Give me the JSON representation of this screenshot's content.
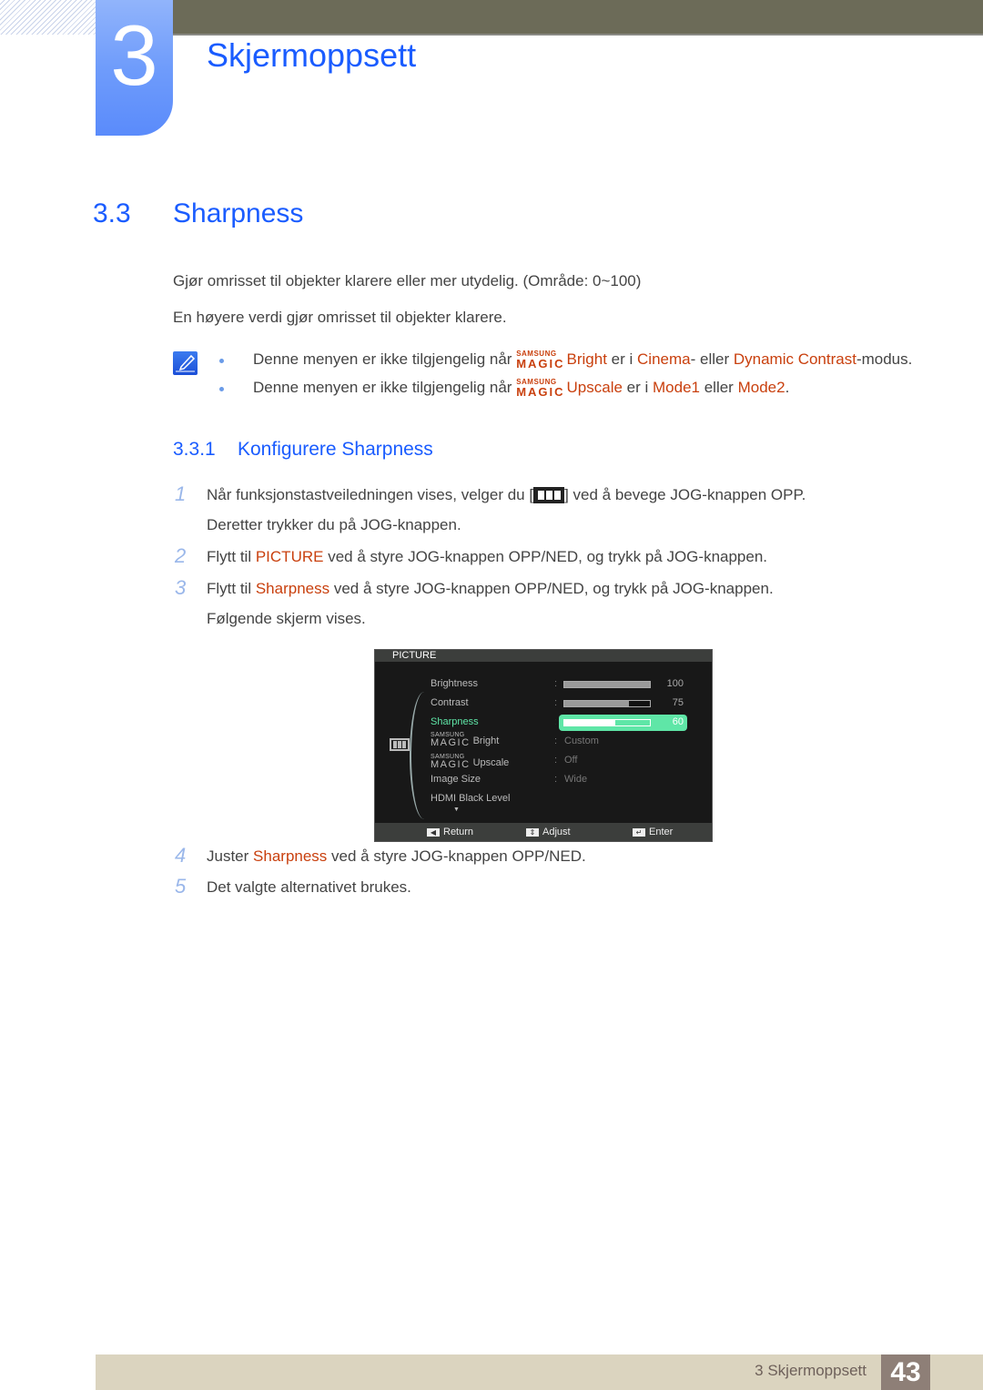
{
  "chapter": {
    "number": "3",
    "title": "Skjermoppsett"
  },
  "section": {
    "number": "3.3",
    "title": "Sharpness"
  },
  "intro": [
    "Gjør omrisset til objekter klarere eller mer utydelig. (Område: 0~100)",
    "En høyere verdi gjør omrisset til objekter klarere."
  ],
  "notes": [
    {
      "pre": "Denne menyen er ikke tilgjengelig når",
      "magic_top": "SAMSUNG",
      "magic_bottom": "MAGIC",
      "feature": "Bright",
      "mid": " er i ",
      "opt1": "Cinema",
      "mid2": "- eller ",
      "opt2": "Dynamic Contrast",
      "post": "-modus."
    },
    {
      "pre": "Denne menyen er ikke tilgjengelig når",
      "magic_top": "SAMSUNG",
      "magic_bottom": "MAGIC",
      "feature": "Upscale",
      "mid": " er i ",
      "opt1": "Mode1",
      "mid2": " eller ",
      "opt2": "Mode2",
      "post": "."
    }
  ],
  "subsection": {
    "number": "3.3.1",
    "title": "Konfigurere Sharpness"
  },
  "steps": [
    {
      "num": "1",
      "a": "Når funksjonstastveiledningen vises, velger du [",
      "b": "] ved å bevege JOG-knappen OPP.",
      "line2": "Deretter trykker du på JOG-knappen."
    },
    {
      "num": "2",
      "a": "Flytt til ",
      "hl": "PICTURE",
      "b": " ved å styre JOG-knappen OPP/NED, og trykk på JOG-knappen."
    },
    {
      "num": "3",
      "a": "Flytt til ",
      "hl": "Sharpness",
      "b": " ved å styre JOG-knappen OPP/NED, og trykk på JOG-knappen.",
      "line2": "Følgende skjerm vises."
    },
    {
      "num": "4",
      "a": "Juster ",
      "hl": "Sharpness",
      "b": " ved å styre JOG-knappen OPP/NED."
    },
    {
      "num": "5",
      "a": "Det valgte alternativet brukes."
    }
  ],
  "osd": {
    "title": "PICTURE",
    "items": [
      {
        "label": "Brightness",
        "value": 100,
        "value_text": "100"
      },
      {
        "label": "Contrast",
        "value": 75,
        "value_text": "75"
      },
      {
        "label": "Sharpness",
        "value": 60,
        "value_text": "60",
        "selected": true
      },
      {
        "magic_top": "SAMSUNG",
        "magic_bottom": "MAGIC",
        "label": "Bright",
        "value_text": "Custom"
      },
      {
        "magic_top": "SAMSUNG",
        "magic_bottom": "MAGIC",
        "label": "Upscale",
        "value_text": "Off"
      },
      {
        "label": "Image Size",
        "value_text": "Wide"
      },
      {
        "label": "HDMI Black Level"
      }
    ],
    "footer": {
      "return": "Return",
      "adjust": "Adjust",
      "enter": "Enter"
    }
  },
  "footer": {
    "chapter_label": "3 Skjermoppsett",
    "page": "43"
  },
  "colors": {
    "heading_blue": "#1a5cff",
    "highlight": "#c9400e",
    "osd_selected": "#5fe6a7"
  }
}
